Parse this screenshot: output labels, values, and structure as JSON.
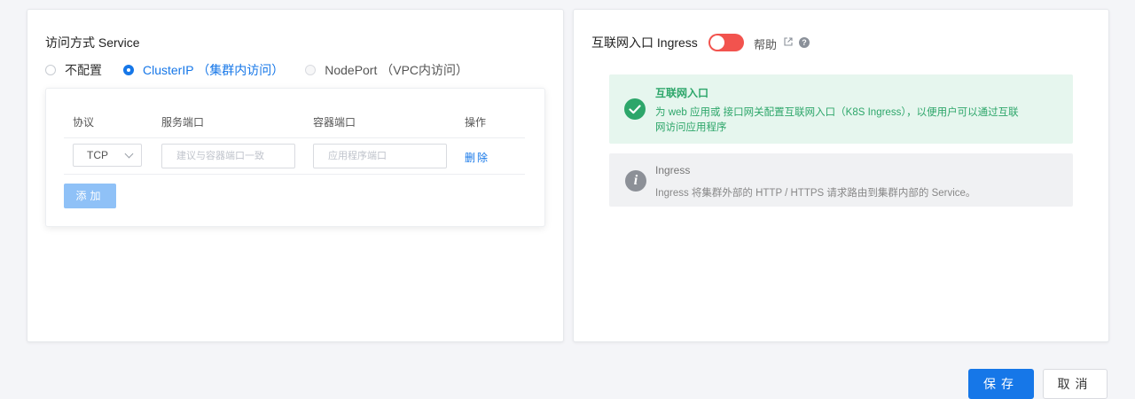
{
  "service": {
    "title": "访问方式 Service",
    "options": [
      "不配置",
      "ClusterIP （集群内访问）",
      "NodePort （VPC内访问）"
    ],
    "selected": "ClusterIP （集群内访问）"
  },
  "port_table": {
    "headers": [
      "协议",
      "服务端口",
      "容器端口",
      "操作"
    ],
    "rows": [
      {
        "protocol": "TCP",
        "service_port_placeholder": "建议与容器端口一致",
        "container_port_placeholder": "应用程序端口",
        "action": "删除"
      }
    ],
    "add_label": "添加"
  },
  "ingress": {
    "title": "互联网入口 Ingress",
    "toggle_on": false,
    "help_label": "帮助",
    "success_alert": {
      "title": "互联网入口",
      "description": "为 web 应用或 接口网关配置互联网入口（K8S Ingress），以便用户可以通过互联网访问应用程序"
    },
    "info_alert": {
      "title": "Ingress",
      "description": "Ingress 将集群外部的 HTTP / HTTPS 请求路由到集群内部的 Service。"
    }
  },
  "footer": {
    "save_label": "保存",
    "cancel_label": "取消"
  },
  "colors": {
    "primary": "#1677e8",
    "success": "#2da66a",
    "toggle_off": "#f2534e"
  }
}
